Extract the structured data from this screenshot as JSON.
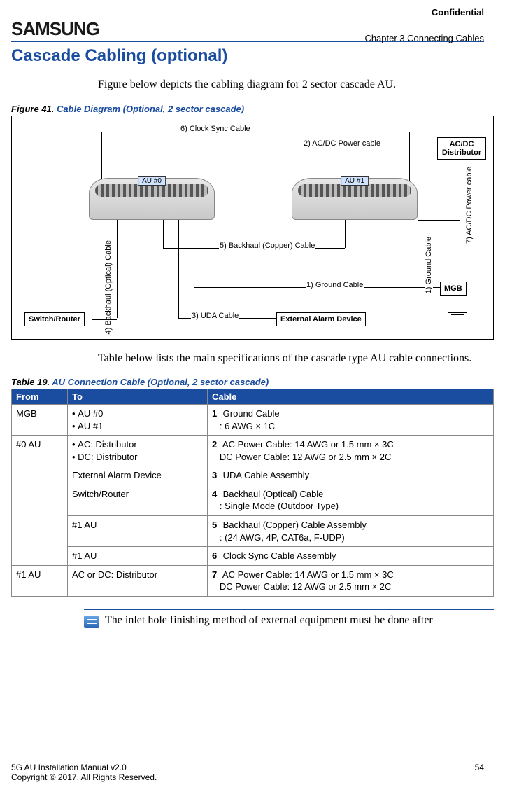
{
  "header": {
    "confidential": "Confidential",
    "logo": "SAMSUNG",
    "chapter": "Chapter 3 Connecting Cables"
  },
  "section": {
    "title": "Cascade Cabling (optional)",
    "intro": "Figure below depicts the cabling diagram for 2 sector cascade AU.",
    "after_figure": "Table below lists the main specifications of the cascade type AU cable connections."
  },
  "figure": {
    "prefix": "Figure 41. ",
    "title": "Cable Diagram (Optional, 2 sector cascade)",
    "labels": {
      "l1": "1)  Ground Cable",
      "l1v": "1)  Ground Cable",
      "l2": "2)  AC/DC Power cable",
      "l3": "3)  UDA Cable",
      "l4": "4)  Backhaul (Optical) Cable",
      "l5": "5)  Backhaul (Copper) Cable",
      "l6": "6)  Clock Sync Cable",
      "l7": "7)  AC/DC Power cable"
    },
    "boxes": {
      "au0": "AU #0",
      "au1": "AU #1",
      "acdc": "AC/DC Distributor",
      "mgb": "MGB",
      "switch": "Switch/Router",
      "alarm": "External Alarm Device"
    }
  },
  "table": {
    "prefix": "Table 19. ",
    "title": "AU Connection Cable (Optional, 2 sector cascade)",
    "headers": {
      "from": "From",
      "to": "To",
      "cable": "Cable"
    },
    "rows": {
      "r1": {
        "from": "MGB",
        "to1": "AU #0",
        "to2": "AU #1",
        "cnum": "1",
        "cname": "Ground Cable",
        "cdet": ": 6 AWG × 1C"
      },
      "r2": {
        "from": "#0 AU",
        "to1": "AC: Distributor",
        "to2": "DC: Distributor",
        "cnum": "2",
        "cname": "AC Power Cable: 14 AWG or 1.5 mm × 3C",
        "cdet": "DC Power Cable: 12 AWG or 2.5 mm × 2C"
      },
      "r3": {
        "to": "External Alarm Device",
        "cnum": "3",
        "cname": "UDA Cable Assembly"
      },
      "r4": {
        "to": "Switch/Router",
        "cnum": "4",
        "cname": "Backhaul (Optical) Cable",
        "cdet": ": Single Mode (Outdoor Type)"
      },
      "r5": {
        "to": "#1 AU",
        "cnum": "5",
        "cname": "Backhaul (Copper) Cable Assembly",
        "cdet": ": (24 AWG, 4P, CAT6a, F-UDP)"
      },
      "r6": {
        "to": "#1 AU",
        "cnum": "6",
        "cname": "Clock Sync Cable Assembly"
      },
      "r7": {
        "from": "#1 AU",
        "to": "AC or DC: Distributor",
        "cnum": "7",
        "cname": "AC Power Cable: 14 AWG or 1.5 mm × 3C",
        "cdet": "DC Power Cable: 12 AWG or 2.5 mm × 2C"
      }
    }
  },
  "note": {
    "text": "The inlet hole finishing method of external equipment must be done after"
  },
  "footer": {
    "line1": "5G AU Installation Manual   v2.0",
    "line2": "Copyright © 2017, All Rights Reserved.",
    "page": "54"
  }
}
